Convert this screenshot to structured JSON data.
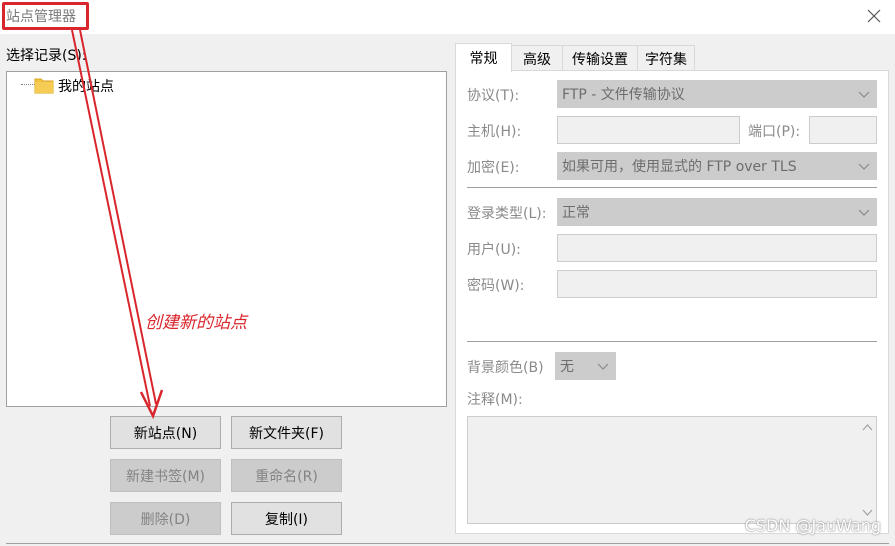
{
  "window": {
    "title": "站点管理器",
    "close_icon": "close-icon"
  },
  "left": {
    "select_label": "选择记录(S):",
    "tree": [
      {
        "label": "我的站点",
        "icon": "folder-icon"
      }
    ],
    "buttons": {
      "new_site": "新站点(N)",
      "new_folder": "新文件夹(F)",
      "new_bookmark": "新建书签(M)",
      "rename": "重命名(R)",
      "delete": "删除(D)",
      "copy": "复制(I)"
    }
  },
  "tabs": [
    "常规",
    "高级",
    "传输设置",
    "字符集"
  ],
  "general": {
    "protocol_label": "协议(T):",
    "protocol_value": "FTP - 文件传输协议",
    "host_label": "主机(H):",
    "host_value": "",
    "port_label": "端口(P):",
    "port_value": "",
    "encryption_label": "加密(E):",
    "encryption_value": "如果可用，使用显式的 FTP over TLS",
    "logon_type_label": "登录类型(L):",
    "logon_type_value": "正常",
    "user_label": "用户(U):",
    "user_value": "",
    "password_label": "密码(W):",
    "password_value": "",
    "bg_color_label": "背景颜色(B)",
    "bg_color_value": "无",
    "notes_label": "注释(M):",
    "notes_value": ""
  },
  "annotation": {
    "text": "创建新的站点",
    "color": "#d9262d"
  },
  "watermark": "CSDN @JauWang",
  "colors": {
    "accent_red": "#d9262d",
    "folder_yellow": "#f5c242",
    "disabled_text": "#8a8a8a"
  }
}
